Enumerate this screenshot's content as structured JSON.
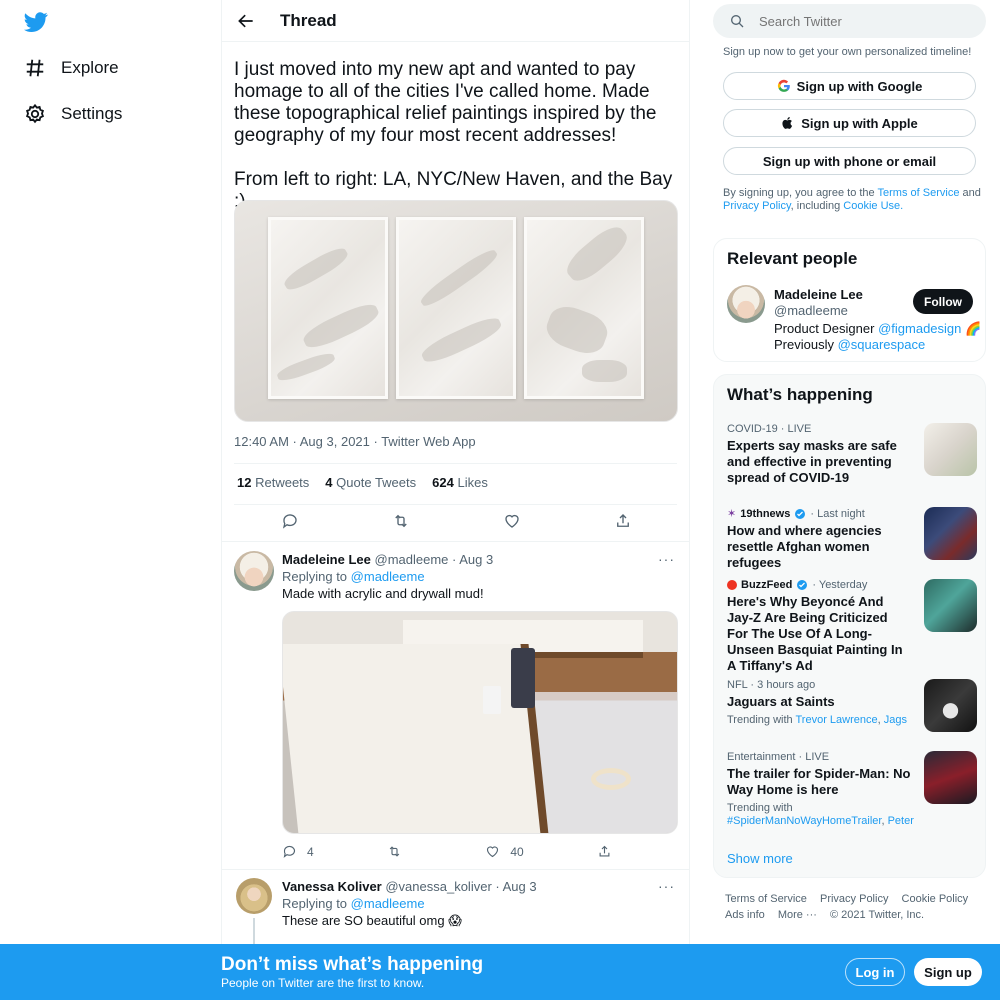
{
  "nav": {
    "items": [
      {
        "label": "Explore",
        "icon": "hashtag-icon"
      },
      {
        "label": "Settings",
        "icon": "gear-icon"
      }
    ]
  },
  "thread": {
    "title": "Thread",
    "text": "I just moved into my new apt and wanted to pay homage to all of the cities I've called home. Made these topographical relief paintings inspired by the geography of my four most recent addresses!\n\nFrom left to right: LA, NYC/New Haven, and the Bay :)",
    "meta": "12:40 AM · Aug 3, 2021 · Twitter Web App",
    "retweets_count": "12",
    "retweets_label": "Retweets",
    "quotes_count": "4",
    "quotes_label": "Quote Tweets",
    "likes_count": "624",
    "likes_label": "Likes"
  },
  "replies": [
    {
      "name": "Madeleine Lee",
      "handle_date": "@madleeme · Aug 3",
      "replying_prefix": "Replying to",
      "replying_to": "@madleeme",
      "text": "Made with acrylic and drywall mud!",
      "reply_count": "4",
      "retweet_count": "",
      "like_count": "40"
    },
    {
      "name": "Vanessa Koliver",
      "handle_date": "@vanessa_koliver · Aug 3",
      "replying_prefix": "Replying to",
      "replying_to": "@madleeme",
      "text": "These are SO beautiful omg 😱"
    }
  ],
  "search": {
    "placeholder": "Search Twitter"
  },
  "signup": {
    "note": "Sign up now to get your own personalized timeline!",
    "google": "Sign up with Google",
    "apple": "Sign up with Apple",
    "phone": "Sign up with phone or email",
    "terms_1": "By signing up, you agree to the",
    "terms_tos": "Terms of Service",
    "terms_and": "and",
    "terms_privacy": "Privacy Policy",
    "terms_including": ", including",
    "terms_cookie": "Cookie Use."
  },
  "relevant": {
    "title": "Relevant people",
    "name": "Madeleine Lee",
    "handle": "@madleeme",
    "follow": "Follow",
    "bio_1": "Product Designer",
    "bio_link_1": "@figmadesign",
    "bio_emoji": "🌈",
    "bio_2": "Previously",
    "bio_link_2": "@squarespace"
  },
  "happening": {
    "title": "What’s happening",
    "trends": [
      {
        "category": "COVID-19 · LIVE",
        "headline": "Experts say masks are safe and effective in preventing spread of COVID-19"
      },
      {
        "source": "19thnews",
        "time": "· Last night",
        "headline": "How and where agencies resettle Afghan women refugees"
      },
      {
        "source": "BuzzFeed",
        "time": "· Yesterday",
        "headline": "Here's Why Beyoncé And Jay-Z Are Being Criticized For The Use Of A Long-Unseen Basquiat Painting In A Tiffany's Ad"
      },
      {
        "category": "NFL · 3 hours ago",
        "headline": "Jaguars at Saints",
        "trending_prefix": "Trending with",
        "trending_1": "Trevor Lawrence",
        "trending_2": "Jags"
      },
      {
        "category": "Entertainment · LIVE",
        "headline": "The trailer for Spider-Man: No Way Home is here",
        "trending_prefix": "Trending with",
        "trending_1": "#SpiderManNoWayHomeTrailer",
        "trending_2": "Peter"
      }
    ],
    "show_more": "Show more"
  },
  "footer": {
    "tos": "Terms of Service",
    "privacy": "Privacy Policy",
    "cookie": "Cookie Policy",
    "ads": "Ads info",
    "more": "More ···",
    "copyright": "© 2021 Twitter, Inc."
  },
  "bottombar": {
    "title": "Don’t miss what’s happening",
    "subtitle": "People on Twitter are the first to know.",
    "login": "Log in",
    "signup": "Sign up"
  },
  "colors": {
    "accent": "#1d9bf0",
    "text": "#0f1419",
    "muted": "#536471"
  }
}
